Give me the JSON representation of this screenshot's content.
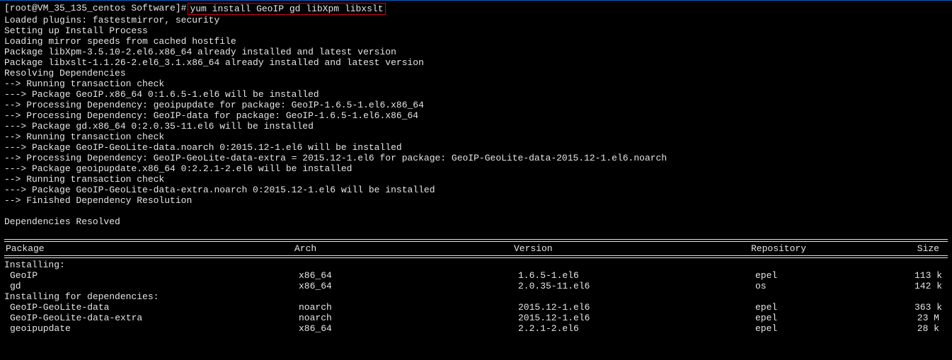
{
  "prompt": {
    "prefix": "[root@VM_35_135_centos Software]# ",
    "command": "yum install GeoIP gd libXpm libxslt"
  },
  "output_lines": [
    "Loaded plugins: fastestmirror, security",
    "Setting up Install Process",
    "Loading mirror speeds from cached hostfile",
    "Package libXpm-3.5.10-2.el6.x86_64 already installed and latest version",
    "Package libxslt-1.1.26-2.el6_3.1.x86_64 already installed and latest version",
    "Resolving Dependencies",
    "--> Running transaction check",
    "---> Package GeoIP.x86_64 0:1.6.5-1.el6 will be installed",
    "--> Processing Dependency: geoipupdate for package: GeoIP-1.6.5-1.el6.x86_64",
    "--> Processing Dependency: GeoIP-data for package: GeoIP-1.6.5-1.el6.x86_64",
    "---> Package gd.x86_64 0:2.0.35-11.el6 will be installed",
    "--> Running transaction check",
    "---> Package GeoIP-GeoLite-data.noarch 0:2015.12-1.el6 will be installed",
    "--> Processing Dependency: GeoIP-GeoLite-data-extra = 2015.12-1.el6 for package: GeoIP-GeoLite-data-2015.12-1.el6.noarch",
    "---> Package geoipupdate.x86_64 0:2.2.1-2.el6 will be installed",
    "--> Running transaction check",
    "---> Package GeoIP-GeoLite-data-extra.noarch 0:2015.12-1.el6 will be installed",
    "--> Finished Dependency Resolution",
    "",
    "Dependencies Resolved",
    ""
  ],
  "table": {
    "headers": {
      "package": "Package",
      "arch": "Arch",
      "version": "Version",
      "repo": "Repository",
      "size": "Size"
    },
    "sections": [
      {
        "label": "Installing:",
        "rows": [
          {
            "package": "GeoIP",
            "arch": "x86_64",
            "version": "1.6.5-1.el6",
            "repo": "epel",
            "size": "113 k"
          },
          {
            "package": "gd",
            "arch": "x86_64",
            "version": "2.0.35-11.el6",
            "repo": "os",
            "size": "142 k"
          }
        ]
      },
      {
        "label": "Installing for dependencies:",
        "rows": [
          {
            "package": "GeoIP-GeoLite-data",
            "arch": "noarch",
            "version": "2015.12-1.el6",
            "repo": "epel",
            "size": "363 k"
          },
          {
            "package": "GeoIP-GeoLite-data-extra",
            "arch": "noarch",
            "version": "2015.12-1.el6",
            "repo": "epel",
            "size": "23 M"
          },
          {
            "package": "geoipupdate",
            "arch": "x86_64",
            "version": "2.2.1-2.el6",
            "repo": "epel",
            "size": "28 k"
          }
        ]
      }
    ]
  }
}
